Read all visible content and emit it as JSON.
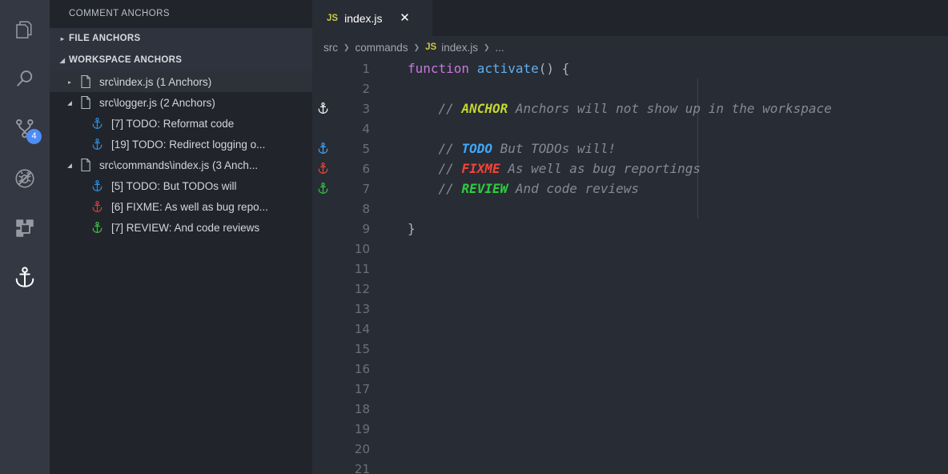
{
  "activity_bar": {
    "items": [
      {
        "name": "explorer",
        "icon": "files-icon",
        "active": false,
        "badge": null
      },
      {
        "name": "search",
        "icon": "search-icon",
        "active": false,
        "badge": null
      },
      {
        "name": "source-control",
        "icon": "source-control-icon",
        "active": false,
        "badge": "4"
      },
      {
        "name": "run-and-debug",
        "icon": "debug-disabled-icon",
        "active": false,
        "badge": null
      },
      {
        "name": "extensions",
        "icon": "extensions-icon",
        "active": false,
        "badge": null
      },
      {
        "name": "comment-anchors",
        "icon": "anchor-icon",
        "active": true,
        "badge": null
      }
    ]
  },
  "sidebar": {
    "title": "COMMENT ANCHORS",
    "sections": [
      {
        "label": "FILE ANCHORS",
        "expanded": false,
        "twisty": "▸"
      },
      {
        "label": "WORKSPACE ANCHORS",
        "expanded": true,
        "twisty": "◢"
      }
    ],
    "tree": [
      {
        "label": "src\\index.js (1 Anchors)",
        "type": "file",
        "expanded": false,
        "twisty": "▸",
        "hover": true,
        "indent": 16
      },
      {
        "label": "src\\logger.js (2 Anchors)",
        "type": "file",
        "expanded": true,
        "twisty": "◢",
        "hover": false,
        "indent": 16
      },
      {
        "label": "[7] TODO: Reformat code",
        "type": "anchor",
        "color": "#2f8fe0",
        "hover": false,
        "indent": 48
      },
      {
        "label": "[19] TODO: Redirect logging o...",
        "type": "anchor",
        "color": "#2f8fe0",
        "hover": false,
        "indent": 48
      },
      {
        "label": "src\\commands\\index.js (3 Anch...",
        "type": "file",
        "expanded": true,
        "twisty": "◢",
        "hover": false,
        "indent": 16
      },
      {
        "label": "[5] TODO: But TODOs will",
        "type": "anchor",
        "color": "#2f8fe0",
        "hover": false,
        "indent": 48
      },
      {
        "label": "[6] FIXME: As well as bug repo...",
        "type": "anchor",
        "color": "#e03b3b",
        "hover": false,
        "indent": 48
      },
      {
        "label": "[7] REVIEW: And code reviews",
        "type": "anchor",
        "color": "#3ec23e",
        "hover": false,
        "indent": 48
      }
    ]
  },
  "editor": {
    "tab": {
      "file_type_badge": "JS",
      "name": "index.js",
      "close_glyph": "✕"
    },
    "breadcrumb": {
      "parts": [
        "src",
        "commands"
      ],
      "file_badge": "JS",
      "file": "index.js",
      "ellipsis": "...",
      "separator": "❯"
    },
    "line_numbers": [
      1,
      2,
      3,
      4,
      5,
      6,
      7,
      8,
      9,
      10,
      11,
      12,
      13,
      14,
      15,
      16,
      17,
      18,
      19,
      20,
      21
    ],
    "gutter_anchors": [
      {
        "line": 3,
        "color": "#ffffff"
      },
      {
        "line": 5,
        "color": "#3ea8ff"
      },
      {
        "line": 6,
        "color": "#f44336"
      },
      {
        "line": 7,
        "color": "#2ecc40"
      }
    ],
    "lines": [
      {
        "n": 1,
        "tokens": [
          {
            "t": "function ",
            "c": "kw"
          },
          {
            "t": "activate",
            "c": "fn"
          },
          {
            "t": "() {",
            "c": "pl"
          }
        ]
      },
      {
        "n": 2,
        "tokens": []
      },
      {
        "n": 3,
        "tokens": [
          {
            "t": "    // ",
            "c": "cm"
          },
          {
            "t": "ANCHOR",
            "c": "tag-anchor"
          },
          {
            "t": " Anchors will not show up in the workspace",
            "c": "cm"
          }
        ]
      },
      {
        "n": 4,
        "tokens": []
      },
      {
        "n": 5,
        "tokens": [
          {
            "t": "    // ",
            "c": "cm"
          },
          {
            "t": "TODO",
            "c": "tag-todo"
          },
          {
            "t": " But TODOs will!",
            "c": "cm"
          }
        ]
      },
      {
        "n": 6,
        "tokens": [
          {
            "t": "    // ",
            "c": "cm"
          },
          {
            "t": "FIXME",
            "c": "tag-fixme"
          },
          {
            "t": " As well as bug reportings",
            "c": "cm"
          }
        ]
      },
      {
        "n": 7,
        "tokens": [
          {
            "t": "    // ",
            "c": "cm"
          },
          {
            "t": "REVIEW",
            "c": "tag-review"
          },
          {
            "t": " And code reviews",
            "c": "cm"
          }
        ]
      },
      {
        "n": 8,
        "tokens": []
      },
      {
        "n": 9,
        "tokens": [
          {
            "t": "}",
            "c": "pl"
          }
        ]
      },
      {
        "n": 10,
        "tokens": []
      },
      {
        "n": 11,
        "tokens": []
      },
      {
        "n": 12,
        "tokens": []
      },
      {
        "n": 13,
        "tokens": []
      },
      {
        "n": 14,
        "tokens": []
      },
      {
        "n": 15,
        "tokens": []
      },
      {
        "n": 16,
        "tokens": []
      },
      {
        "n": 17,
        "tokens": []
      },
      {
        "n": 18,
        "tokens": []
      },
      {
        "n": 19,
        "tokens": []
      },
      {
        "n": 20,
        "tokens": []
      },
      {
        "n": 21,
        "tokens": []
      }
    ]
  },
  "colors": {
    "activity_bar_bg": "#333842",
    "sidebar_bg": "#21252b",
    "section_header_bg": "#2f333d",
    "hover_row_bg": "#2c313a",
    "editor_bg": "#282c34",
    "tab_bar_bg": "#21252b",
    "badge_bg": "#4d8df6",
    "keyword": "#c678dd",
    "function": "#61afef",
    "comment": "#848a95",
    "anchor_tag": "#c3d62f",
    "todo_tag": "#3ea8ff",
    "fixme_tag": "#f44336",
    "review_tag": "#2ecc40"
  }
}
